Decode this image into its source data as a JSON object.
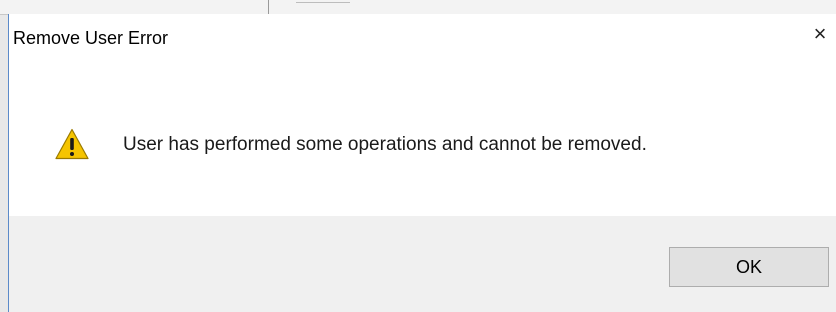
{
  "dialog": {
    "title": "Remove User Error",
    "close_glyph": "×",
    "icon": "warning-icon",
    "message": "User has performed some operations and cannot be removed.",
    "ok_label": "OK"
  },
  "colors": {
    "dialog_background": "#ffffff",
    "footer_background": "#f0f0f0",
    "button_background": "#e1e1e1",
    "button_border": "#adadad",
    "window_border": "#5b8ac9",
    "warning_yellow": "#f5c400"
  }
}
